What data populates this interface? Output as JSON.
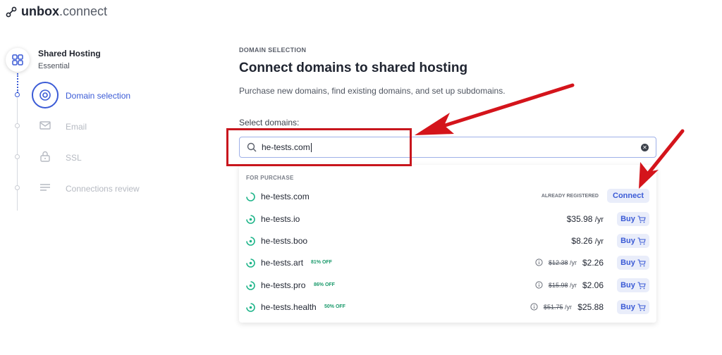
{
  "logo": {
    "bold": "unbox",
    "light": ".connect"
  },
  "sidebar": {
    "plan_title": "Shared Hosting",
    "plan_subtitle": "Essential",
    "steps": [
      {
        "label": "Domain selection",
        "icon": "target-icon",
        "active": true
      },
      {
        "label": "Email",
        "icon": "mail-icon",
        "active": false
      },
      {
        "label": "SSL",
        "icon": "lock-icon",
        "active": false
      },
      {
        "label": "Connections review",
        "icon": "list-icon",
        "active": false
      }
    ]
  },
  "main": {
    "eyebrow": "DOMAIN SELECTION",
    "heading": "Connect domains to shared hosting",
    "subtitle": "Purchase new domains, find existing domains, and set up subdomains.",
    "select_label": "Select domains:",
    "search": {
      "value": "he-tests.com"
    }
  },
  "dropdown": {
    "header": "FOR PURCHASE",
    "rows": [
      {
        "domain": "he-tests.com",
        "status_note": "ALREADY REGISTERED",
        "action": "Connect"
      },
      {
        "domain": "he-tests.io",
        "price": "$35.98",
        "per": "/yr",
        "action": "Buy"
      },
      {
        "domain": "he-tests.boo",
        "price": "$8.26",
        "per": "/yr",
        "action": "Buy"
      },
      {
        "domain": "he-tests.art",
        "discount": "81% OFF",
        "old_price": "$12.38",
        "old_per": "/yr",
        "price": "$2.26",
        "action": "Buy"
      },
      {
        "domain": "he-tests.pro",
        "discount": "86% OFF",
        "old_price": "$15.98",
        "old_per": "/yr",
        "price": "$2.06",
        "action": "Buy"
      },
      {
        "domain": "he-tests.health",
        "discount": "50% OFF",
        "old_price": "$51.75",
        "old_per": "/yr",
        "price": "$25.88",
        "action": "Buy"
      }
    ]
  },
  "colors": {
    "accent": "#3b5bd6",
    "annotation_red": "#c8161d",
    "discount_green": "#1a9a6b"
  }
}
